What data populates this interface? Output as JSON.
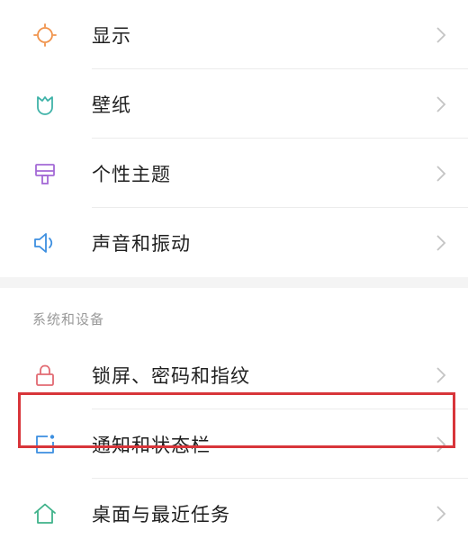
{
  "group_top": {
    "items": [
      {
        "label": "显示",
        "icon": "sun-icon",
        "icon_color": "#f0924a"
      },
      {
        "label": "壁纸",
        "icon": "wallpaper-icon",
        "icon_color": "#3fb2a8"
      },
      {
        "label": "个性主题",
        "icon": "theme-brush-icon",
        "icon_color": "#a46ad6"
      },
      {
        "label": "声音和振动",
        "icon": "speaker-icon",
        "icon_color": "#3d8fe0"
      }
    ]
  },
  "section": {
    "header": "系统和设备",
    "items": [
      {
        "label": "锁屏、密码和指纹",
        "icon": "lock-icon",
        "icon_color": "#e26a72"
      },
      {
        "label": "通知和状态栏",
        "icon": "notification-icon",
        "icon_color": "#3d8fe0"
      },
      {
        "label": "桌面与最近任务",
        "icon": "home-icon",
        "icon_color": "#3fb28a"
      }
    ]
  },
  "highlight_color": "#d8353a"
}
